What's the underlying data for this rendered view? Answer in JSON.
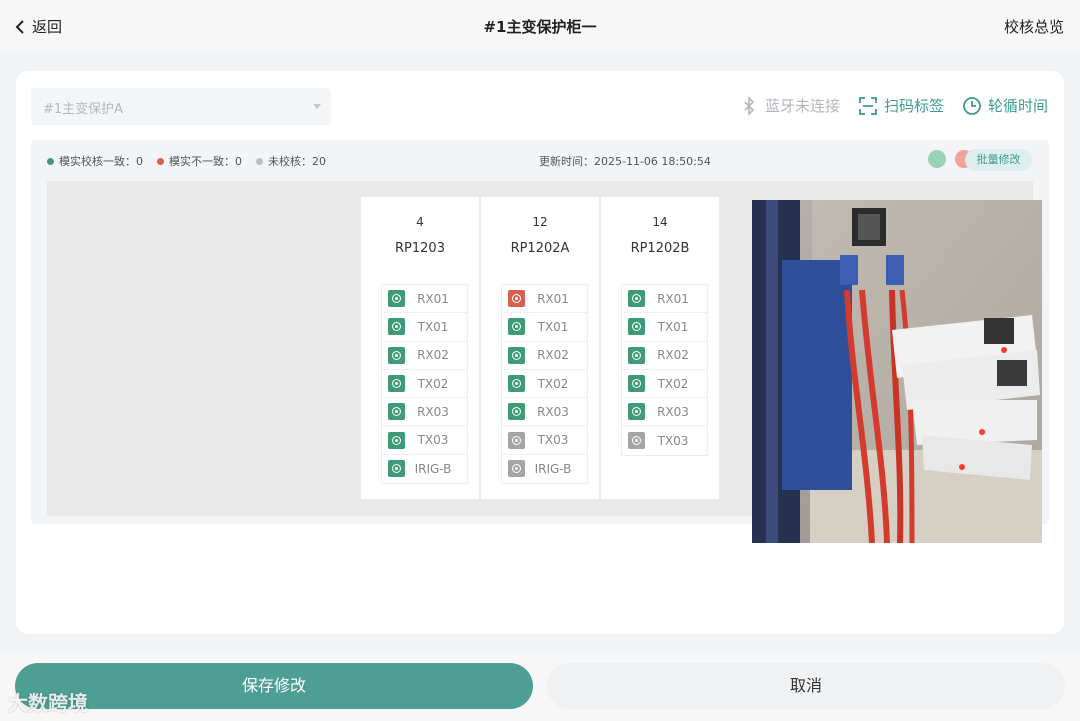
{
  "header": {
    "back_label": "返回",
    "title": "#1主变保护柜一",
    "overview_label": "校核总览"
  },
  "toolbar": {
    "select_value": "#1主变保护A",
    "bluetooth_label": "蓝牙未连接",
    "scan_label": "扫码标签",
    "cycle_label": "轮循时间"
  },
  "legend": {
    "match_label": "模实校核一致：0",
    "mismatch_label": "模实不一致：0",
    "unchecked_label": "未校核：20",
    "update_time": "更新时间：2025-11-06 18:50:54",
    "batch_label": "批量修改"
  },
  "colors": {
    "accent": "#3d9b8f",
    "green": "#3f9a77",
    "red": "#d9604f",
    "gray": "#a5a5a5",
    "circle_green": "#9bd3b6",
    "circle_red": "#eea49a"
  },
  "devices": [
    {
      "num": "4",
      "name": "RP1203",
      "ports": [
        {
          "label": "RX01",
          "status": "green"
        },
        {
          "label": "TX01",
          "status": "green"
        },
        {
          "label": "RX02",
          "status": "green"
        },
        {
          "label": "TX02",
          "status": "green"
        },
        {
          "label": "RX03",
          "status": "green"
        },
        {
          "label": "TX03",
          "status": "green"
        },
        {
          "label": "IRIG-B",
          "status": "green"
        }
      ]
    },
    {
      "num": "12",
      "name": "RP1202A",
      "ports": [
        {
          "label": "RX01",
          "status": "red"
        },
        {
          "label": "TX01",
          "status": "green"
        },
        {
          "label": "RX02",
          "status": "green"
        },
        {
          "label": "TX02",
          "status": "green"
        },
        {
          "label": "RX03",
          "status": "green"
        },
        {
          "label": "TX03",
          "status": "gray"
        },
        {
          "label": "IRIG-B",
          "status": "gray"
        }
      ]
    },
    {
      "num": "14",
      "name": "RP1202B",
      "ports": [
        {
          "label": "RX01",
          "status": "green"
        },
        {
          "label": "TX01",
          "status": "green"
        },
        {
          "label": "RX02",
          "status": "green"
        },
        {
          "label": "TX02",
          "status": "green"
        },
        {
          "label": "RX03",
          "status": "green"
        },
        {
          "label": "TX03",
          "status": "gray"
        }
      ]
    }
  ],
  "footer": {
    "save_label": "保存修改",
    "cancel_label": "取消",
    "watermark": "大数跨境"
  }
}
